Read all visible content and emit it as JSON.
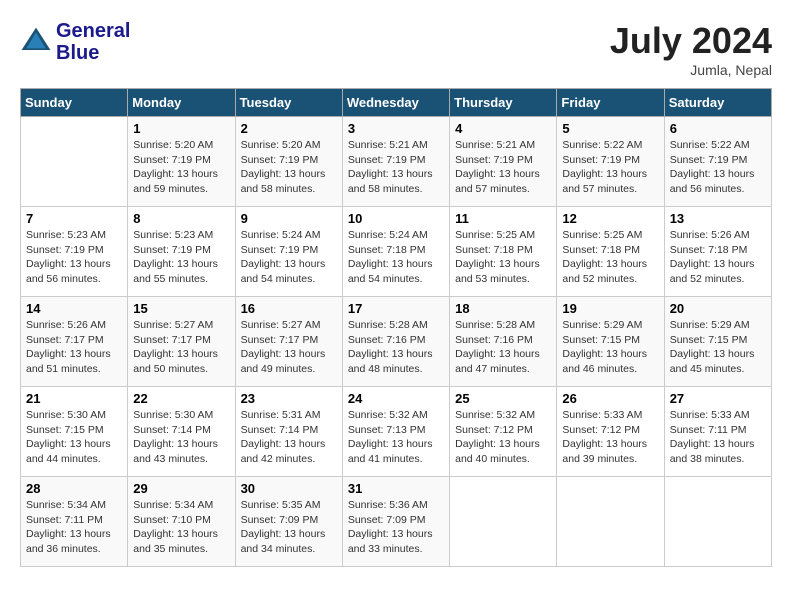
{
  "header": {
    "logo_line1": "General",
    "logo_line2": "Blue",
    "month": "July 2024",
    "location": "Jumla, Nepal"
  },
  "days_of_week": [
    "Sunday",
    "Monday",
    "Tuesday",
    "Wednesday",
    "Thursday",
    "Friday",
    "Saturday"
  ],
  "weeks": [
    [
      {
        "num": "",
        "info": ""
      },
      {
        "num": "1",
        "info": "Sunrise: 5:20 AM\nSunset: 7:19 PM\nDaylight: 13 hours\nand 59 minutes."
      },
      {
        "num": "2",
        "info": "Sunrise: 5:20 AM\nSunset: 7:19 PM\nDaylight: 13 hours\nand 58 minutes."
      },
      {
        "num": "3",
        "info": "Sunrise: 5:21 AM\nSunset: 7:19 PM\nDaylight: 13 hours\nand 58 minutes."
      },
      {
        "num": "4",
        "info": "Sunrise: 5:21 AM\nSunset: 7:19 PM\nDaylight: 13 hours\nand 57 minutes."
      },
      {
        "num": "5",
        "info": "Sunrise: 5:22 AM\nSunset: 7:19 PM\nDaylight: 13 hours\nand 57 minutes."
      },
      {
        "num": "6",
        "info": "Sunrise: 5:22 AM\nSunset: 7:19 PM\nDaylight: 13 hours\nand 56 minutes."
      }
    ],
    [
      {
        "num": "7",
        "info": "Sunrise: 5:23 AM\nSunset: 7:19 PM\nDaylight: 13 hours\nand 56 minutes."
      },
      {
        "num": "8",
        "info": "Sunrise: 5:23 AM\nSunset: 7:19 PM\nDaylight: 13 hours\nand 55 minutes."
      },
      {
        "num": "9",
        "info": "Sunrise: 5:24 AM\nSunset: 7:19 PM\nDaylight: 13 hours\nand 54 minutes."
      },
      {
        "num": "10",
        "info": "Sunrise: 5:24 AM\nSunset: 7:18 PM\nDaylight: 13 hours\nand 54 minutes."
      },
      {
        "num": "11",
        "info": "Sunrise: 5:25 AM\nSunset: 7:18 PM\nDaylight: 13 hours\nand 53 minutes."
      },
      {
        "num": "12",
        "info": "Sunrise: 5:25 AM\nSunset: 7:18 PM\nDaylight: 13 hours\nand 52 minutes."
      },
      {
        "num": "13",
        "info": "Sunrise: 5:26 AM\nSunset: 7:18 PM\nDaylight: 13 hours\nand 52 minutes."
      }
    ],
    [
      {
        "num": "14",
        "info": "Sunrise: 5:26 AM\nSunset: 7:17 PM\nDaylight: 13 hours\nand 51 minutes."
      },
      {
        "num": "15",
        "info": "Sunrise: 5:27 AM\nSunset: 7:17 PM\nDaylight: 13 hours\nand 50 minutes."
      },
      {
        "num": "16",
        "info": "Sunrise: 5:27 AM\nSunset: 7:17 PM\nDaylight: 13 hours\nand 49 minutes."
      },
      {
        "num": "17",
        "info": "Sunrise: 5:28 AM\nSunset: 7:16 PM\nDaylight: 13 hours\nand 48 minutes."
      },
      {
        "num": "18",
        "info": "Sunrise: 5:28 AM\nSunset: 7:16 PM\nDaylight: 13 hours\nand 47 minutes."
      },
      {
        "num": "19",
        "info": "Sunrise: 5:29 AM\nSunset: 7:15 PM\nDaylight: 13 hours\nand 46 minutes."
      },
      {
        "num": "20",
        "info": "Sunrise: 5:29 AM\nSunset: 7:15 PM\nDaylight: 13 hours\nand 45 minutes."
      }
    ],
    [
      {
        "num": "21",
        "info": "Sunrise: 5:30 AM\nSunset: 7:15 PM\nDaylight: 13 hours\nand 44 minutes."
      },
      {
        "num": "22",
        "info": "Sunrise: 5:30 AM\nSunset: 7:14 PM\nDaylight: 13 hours\nand 43 minutes."
      },
      {
        "num": "23",
        "info": "Sunrise: 5:31 AM\nSunset: 7:14 PM\nDaylight: 13 hours\nand 42 minutes."
      },
      {
        "num": "24",
        "info": "Sunrise: 5:32 AM\nSunset: 7:13 PM\nDaylight: 13 hours\nand 41 minutes."
      },
      {
        "num": "25",
        "info": "Sunrise: 5:32 AM\nSunset: 7:12 PM\nDaylight: 13 hours\nand 40 minutes."
      },
      {
        "num": "26",
        "info": "Sunrise: 5:33 AM\nSunset: 7:12 PM\nDaylight: 13 hours\nand 39 minutes."
      },
      {
        "num": "27",
        "info": "Sunrise: 5:33 AM\nSunset: 7:11 PM\nDaylight: 13 hours\nand 38 minutes."
      }
    ],
    [
      {
        "num": "28",
        "info": "Sunrise: 5:34 AM\nSunset: 7:11 PM\nDaylight: 13 hours\nand 36 minutes."
      },
      {
        "num": "29",
        "info": "Sunrise: 5:34 AM\nSunset: 7:10 PM\nDaylight: 13 hours\nand 35 minutes."
      },
      {
        "num": "30",
        "info": "Sunrise: 5:35 AM\nSunset: 7:09 PM\nDaylight: 13 hours\nand 34 minutes."
      },
      {
        "num": "31",
        "info": "Sunrise: 5:36 AM\nSunset: 7:09 PM\nDaylight: 13 hours\nand 33 minutes."
      },
      {
        "num": "",
        "info": ""
      },
      {
        "num": "",
        "info": ""
      },
      {
        "num": "",
        "info": ""
      }
    ]
  ]
}
